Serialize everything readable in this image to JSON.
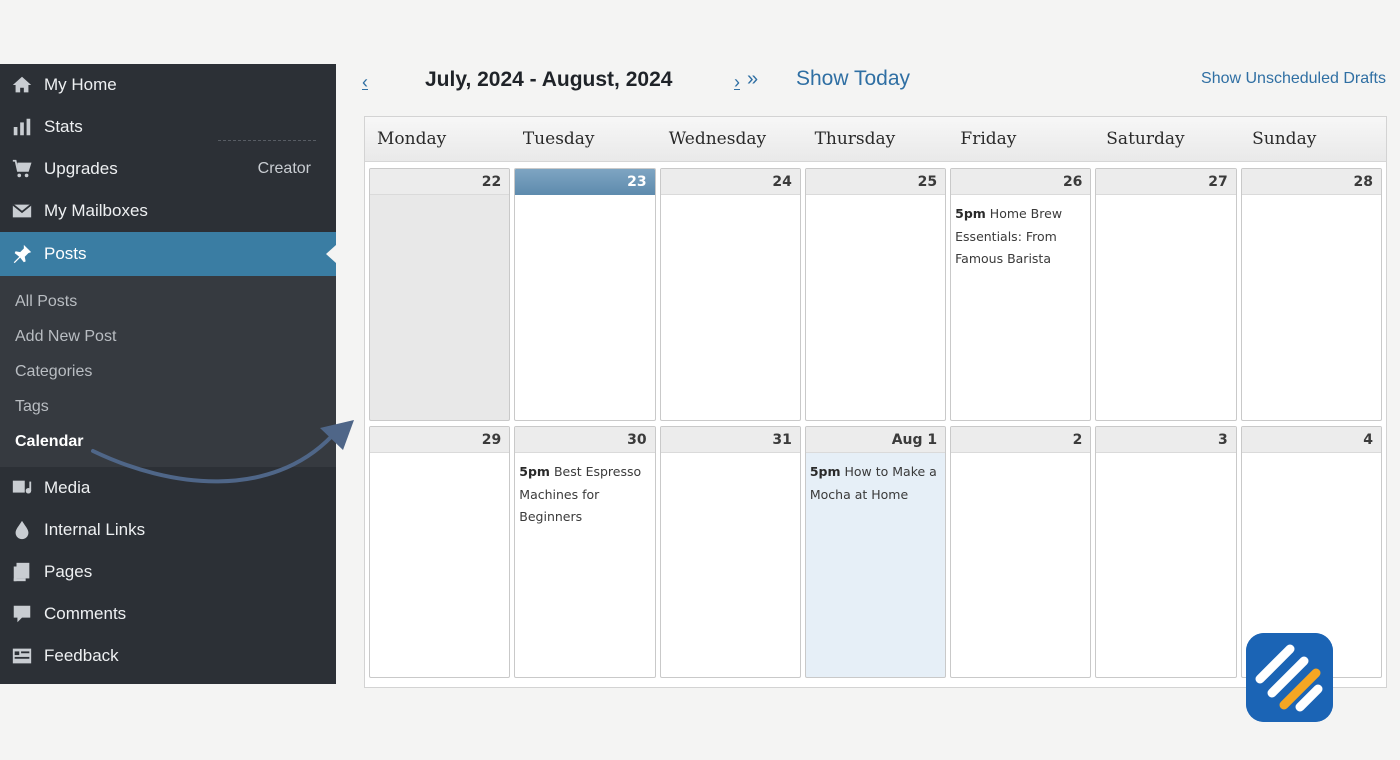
{
  "sidebar": {
    "items_top": [
      {
        "label": "My Home",
        "icon": "home-icon"
      },
      {
        "label": "Stats",
        "icon": "stats-icon"
      },
      {
        "label": "Upgrades",
        "icon": "cart-icon",
        "badge": "Creator"
      },
      {
        "label": "My Mailboxes",
        "icon": "mail-icon"
      },
      {
        "label": "Posts",
        "icon": "pin-icon"
      }
    ],
    "submenu": [
      "All Posts",
      "Add New Post",
      "Categories",
      "Tags",
      "Calendar"
    ],
    "items_bottom": [
      {
        "label": "Media",
        "icon": "media-icon"
      },
      {
        "label": "Internal Links",
        "icon": "drop-icon"
      },
      {
        "label": "Pages",
        "icon": "pages-icon"
      },
      {
        "label": "Comments",
        "icon": "comments-icon"
      },
      {
        "label": "Feedback",
        "icon": "feedback-icon"
      }
    ]
  },
  "toolbar": {
    "prev": "‹",
    "title": "July, 2024 - August, 2024",
    "next": "›",
    "next_fast": "»",
    "show_today": "Show Today",
    "show_drafts": "Show Unscheduled Drafts"
  },
  "calendar": {
    "weekdays": [
      "Monday",
      "Tuesday",
      "Wednesday",
      "Thursday",
      "Friday",
      "Saturday",
      "Sunday"
    ],
    "week1": [
      {
        "day": "22",
        "time": "",
        "title": ""
      },
      {
        "day": "23",
        "time": "",
        "title": ""
      },
      {
        "day": "24",
        "time": "",
        "title": ""
      },
      {
        "day": "25",
        "time": "",
        "title": ""
      },
      {
        "day": "26",
        "time": "5pm",
        "title": "Home Brew Essentials: From Famous Barista"
      },
      {
        "day": "27",
        "time": "",
        "title": ""
      },
      {
        "day": "28",
        "time": "",
        "title": ""
      }
    ],
    "week2": [
      {
        "day": "29",
        "time": "",
        "title": ""
      },
      {
        "day": "30",
        "time": "5pm",
        "title": "Best Espresso Machines for Beginners"
      },
      {
        "day": "31",
        "time": "",
        "title": ""
      },
      {
        "day": "Aug 1",
        "time": "5pm",
        "title": "How to Make a Mocha at Home"
      },
      {
        "day": "2",
        "time": "",
        "title": ""
      },
      {
        "day": "3",
        "time": "",
        "title": ""
      },
      {
        "day": "4",
        "time": "",
        "title": ""
      }
    ]
  },
  "colors": {
    "sidebar_bg": "#2c3036",
    "active_bg": "#3a7da3",
    "link": "#2f6fa3",
    "today_header": "#6d97b8",
    "highlight_day": "#e6eff7",
    "logo_bg": "#1b64b5",
    "logo_accent": "#f5a623"
  }
}
